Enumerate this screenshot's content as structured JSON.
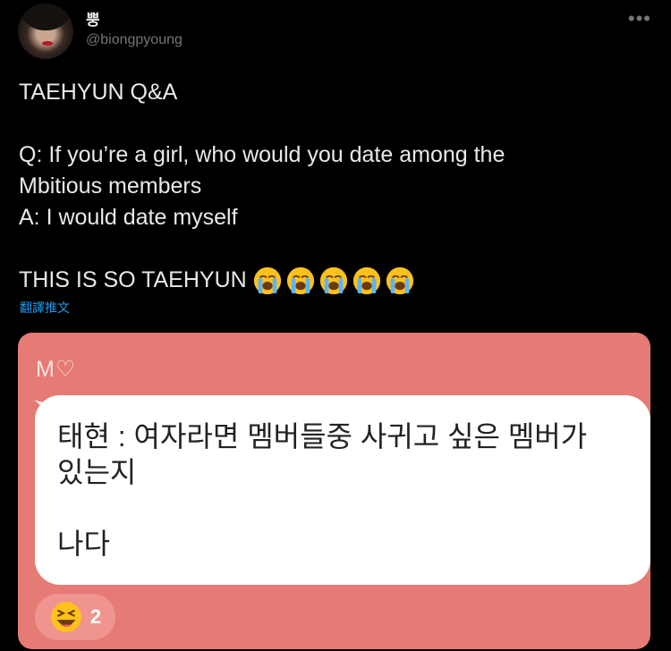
{
  "author": {
    "name": "뿡",
    "handle": "@biongpyoung"
  },
  "tweet": {
    "line1": "TAEHYUN Q&A",
    "line2": "Q: If you’re a girl, who would you date among the\nMbitious members\nA: I would date myself",
    "line3": "THIS IS SO TAEHYUN",
    "emojis": [
      "loudly-crying-face-icon",
      "loudly-crying-face-icon",
      "loudly-crying-face-icon",
      "loudly-crying-face-icon",
      "loudly-crying-face-icon"
    ]
  },
  "translate_link": "翻譯推文",
  "more_icon": "more-icon",
  "card": {
    "logo": "M♡",
    "bubble_text": "태현 : 여자라면 멤버들중 사귀고 싶은 멤버가\n있는지\n\n나다",
    "reaction": {
      "icon": "grinning-squinting-face-icon",
      "count": "2"
    },
    "colors": {
      "background": "#e67a74",
      "bubble": "#ffffff"
    }
  }
}
